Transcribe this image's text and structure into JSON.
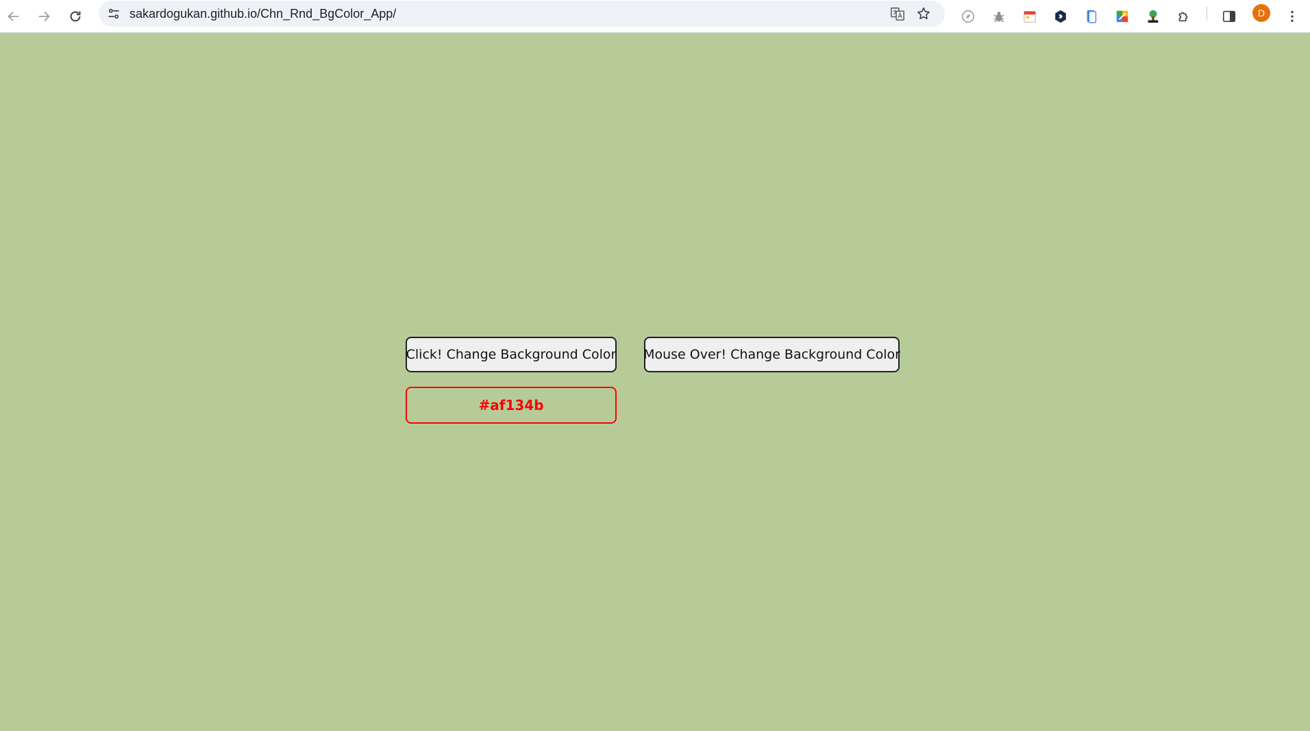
{
  "browser": {
    "url": "sakardogukan.github.io/Chn_Rnd_BgColor_App/",
    "profile_initial": "D",
    "profile_color": "#e8710a",
    "nav_icons": [
      "back-arrow-icon",
      "forward-arrow-icon",
      "reload-icon"
    ],
    "omnibox_icons": [
      "site-info-icon",
      "translate-icon",
      "bookmark-star-icon"
    ],
    "extension_icons": [
      "compass-icon",
      "bug-icon",
      "calendar-icon",
      "hexagon-icon",
      "phone-icon",
      "color-grid-icon",
      "tree-icon",
      "puzzle-icon",
      "side-panel-icon",
      "more-vertical-icon"
    ]
  },
  "page": {
    "background_color": "#b7cb99",
    "click_button_label": "Click! Change Background Color",
    "mouseover_button_label": "Mouse Over! Change Background Color",
    "color_code": "#af134b",
    "color_code_text_color": "#ff0000"
  }
}
